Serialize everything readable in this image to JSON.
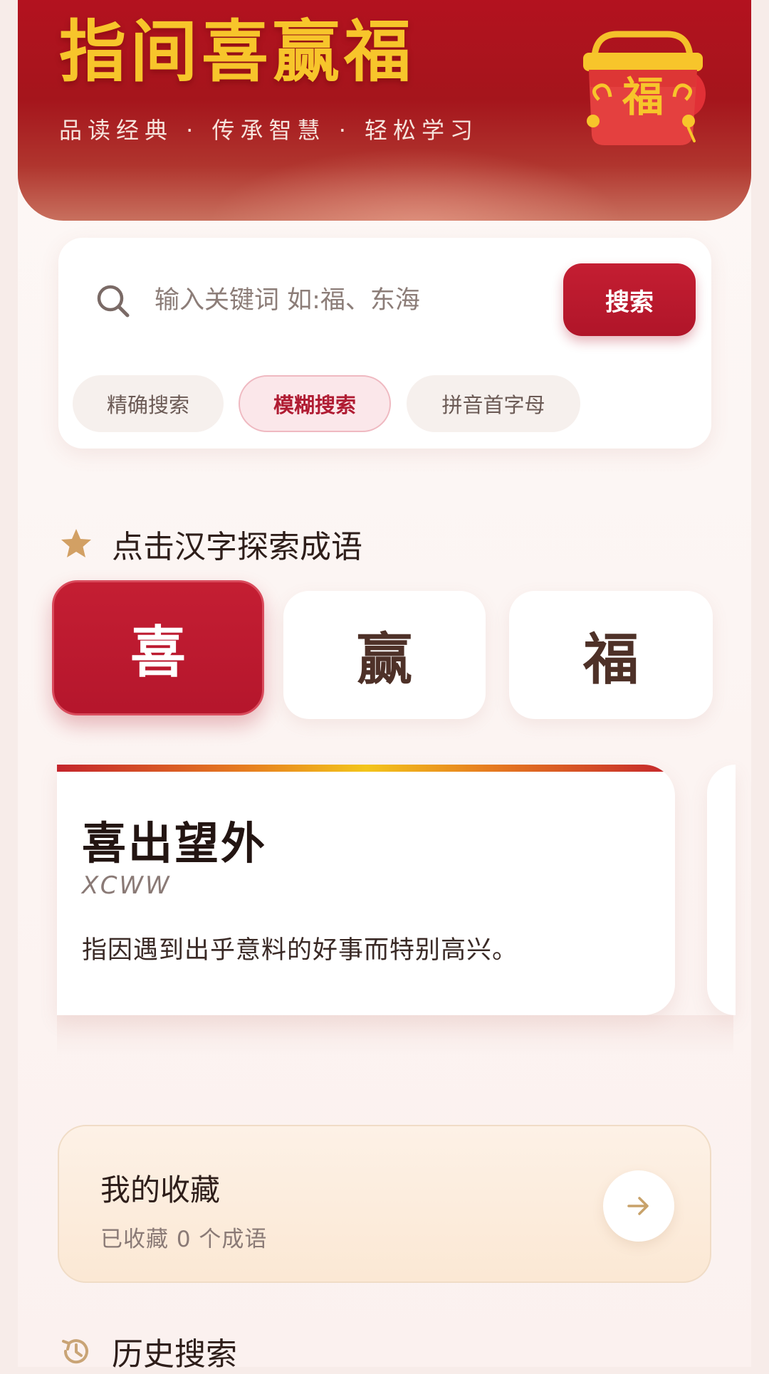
{
  "header": {
    "title": "指间喜赢福",
    "subtitle": "品读经典 · 传承智慧 · 轻松学习",
    "bag_glyph": "福",
    "bag_icon": "fortune-bag-icon"
  },
  "search": {
    "placeholder": "输入关键词 如:福、东海",
    "value": "",
    "button_label": "搜索",
    "icon": "search-icon",
    "modes": [
      {
        "label": "精确搜索",
        "active": false
      },
      {
        "label": "模糊搜索",
        "active": true
      },
      {
        "label": "拼音首字母",
        "active": false
      }
    ]
  },
  "explore": {
    "title": "点击汉字探索成语",
    "icon": "star-icon",
    "chars": [
      {
        "label": "喜",
        "active": true
      },
      {
        "label": "赢",
        "active": false
      },
      {
        "label": "福",
        "active": false
      }
    ]
  },
  "idiom": {
    "word": "喜出望外",
    "abbr": "XCWW",
    "meaning": "指因遇到出乎意料的好事而特别高兴。"
  },
  "favorites": {
    "title": "我的收藏",
    "count_text": "已收藏 0 个成语",
    "icon": "arrow-right-icon"
  },
  "history": {
    "title": "历史搜索",
    "icon": "history-icon"
  },
  "colors": {
    "brand_red": "#b5162c",
    "gold": "#f7c52b",
    "page_bg": "#fcf4f2"
  }
}
